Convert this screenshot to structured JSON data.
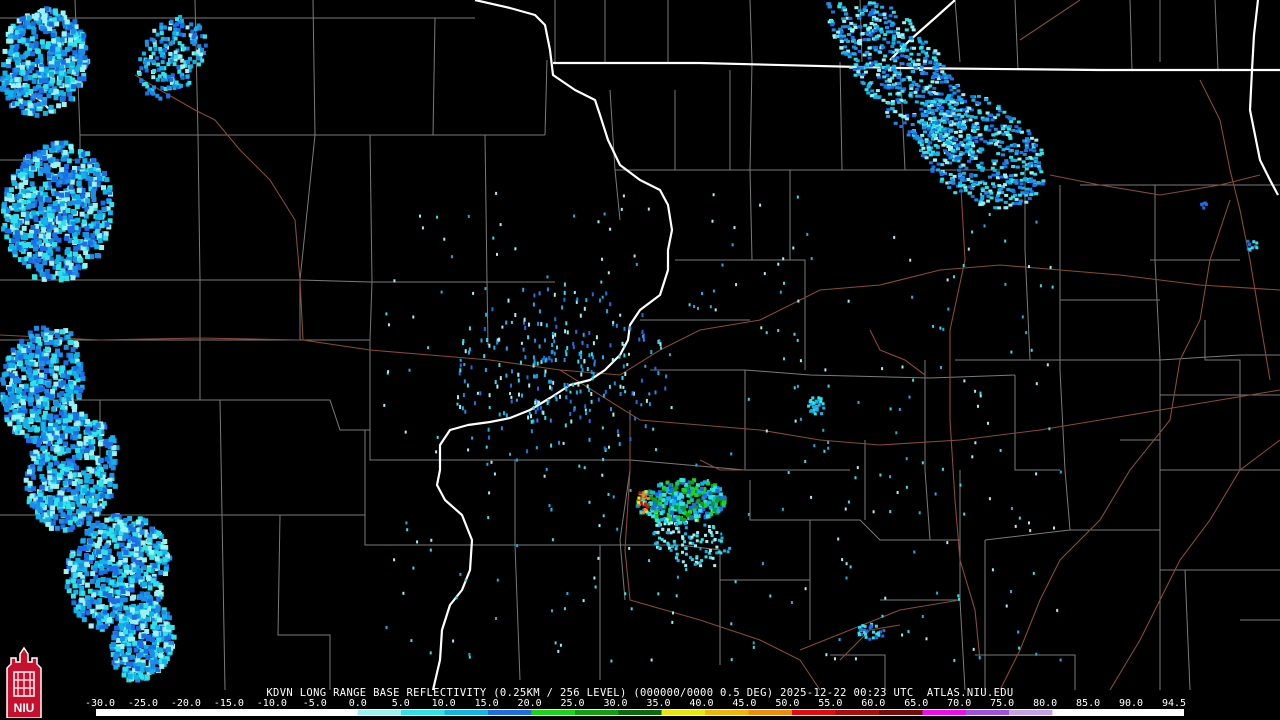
{
  "product": {
    "caption": "KDVN LONG RANGE BASE REFLECTIVITY (0.25KM / 256 LEVEL) (000000/0000 0.5 DEG) 2025-12-22 00:23 UTC  ATLAS.NIU.EDU"
  },
  "colors": {
    "background": "#000000",
    "county_lines": "#7a7a7a",
    "state_lines": "#ffffff",
    "roads": "#8a4a33"
  },
  "scale": {
    "labels": [
      "-30.0",
      "-25.0",
      "-20.0",
      "-15.0",
      "-10.0",
      "-5.0",
      "0.0",
      "5.0",
      "10.0",
      "15.0",
      "20.0",
      "25.0",
      "30.0",
      "35.0",
      "40.0",
      "45.0",
      "50.0",
      "55.0",
      "60.0",
      "65.0",
      "70.0",
      "75.0",
      "80.0",
      "85.0",
      "90.0",
      "94.5"
    ],
    "colors": [
      "#ffffff",
      "#ffffff",
      "#ffffff",
      "#ffffff",
      "#ffffff",
      "#ffffff",
      "#9cf2f2",
      "#2ee2ea",
      "#11b4e8",
      "#1c6ee8",
      "#1cd41c",
      "#10a010",
      "#0b6b0b",
      "#e8e810",
      "#f2b40a",
      "#f28a0a",
      "#e80a0a",
      "#b00a0a",
      "#7a0a0a",
      "#f20af2",
      "#a050e8",
      "#c8a0e8",
      "#ffffff",
      "#ffffff",
      "#ffffff"
    ]
  },
  "logo": {
    "text": "NIU",
    "icon": "niu-tower-logo"
  }
}
